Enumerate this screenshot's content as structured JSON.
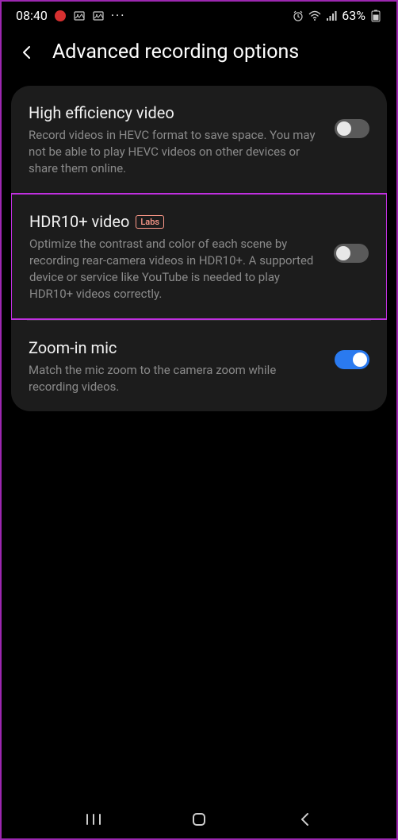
{
  "status": {
    "time": "08:40",
    "battery": "63%"
  },
  "header": {
    "title": "Advanced recording options"
  },
  "settings": [
    {
      "title": "High efficiency video",
      "description": "Record videos in HEVC format to save space. You may not be able to play HEVC videos on other devices or share them online.",
      "enabled": false,
      "labs": false
    },
    {
      "title": "HDR10+ video",
      "description": "Optimize the contrast and color of each scene by recording rear-camera videos in HDR10+. A supported device or service like YouTube is needed to play HDR10+ videos correctly.",
      "enabled": false,
      "labs": true,
      "labs_text": "Labs"
    },
    {
      "title": "Zoom-in mic",
      "description": "Match the mic zoom to the camera zoom while recording videos.",
      "enabled": true,
      "labs": false
    }
  ]
}
